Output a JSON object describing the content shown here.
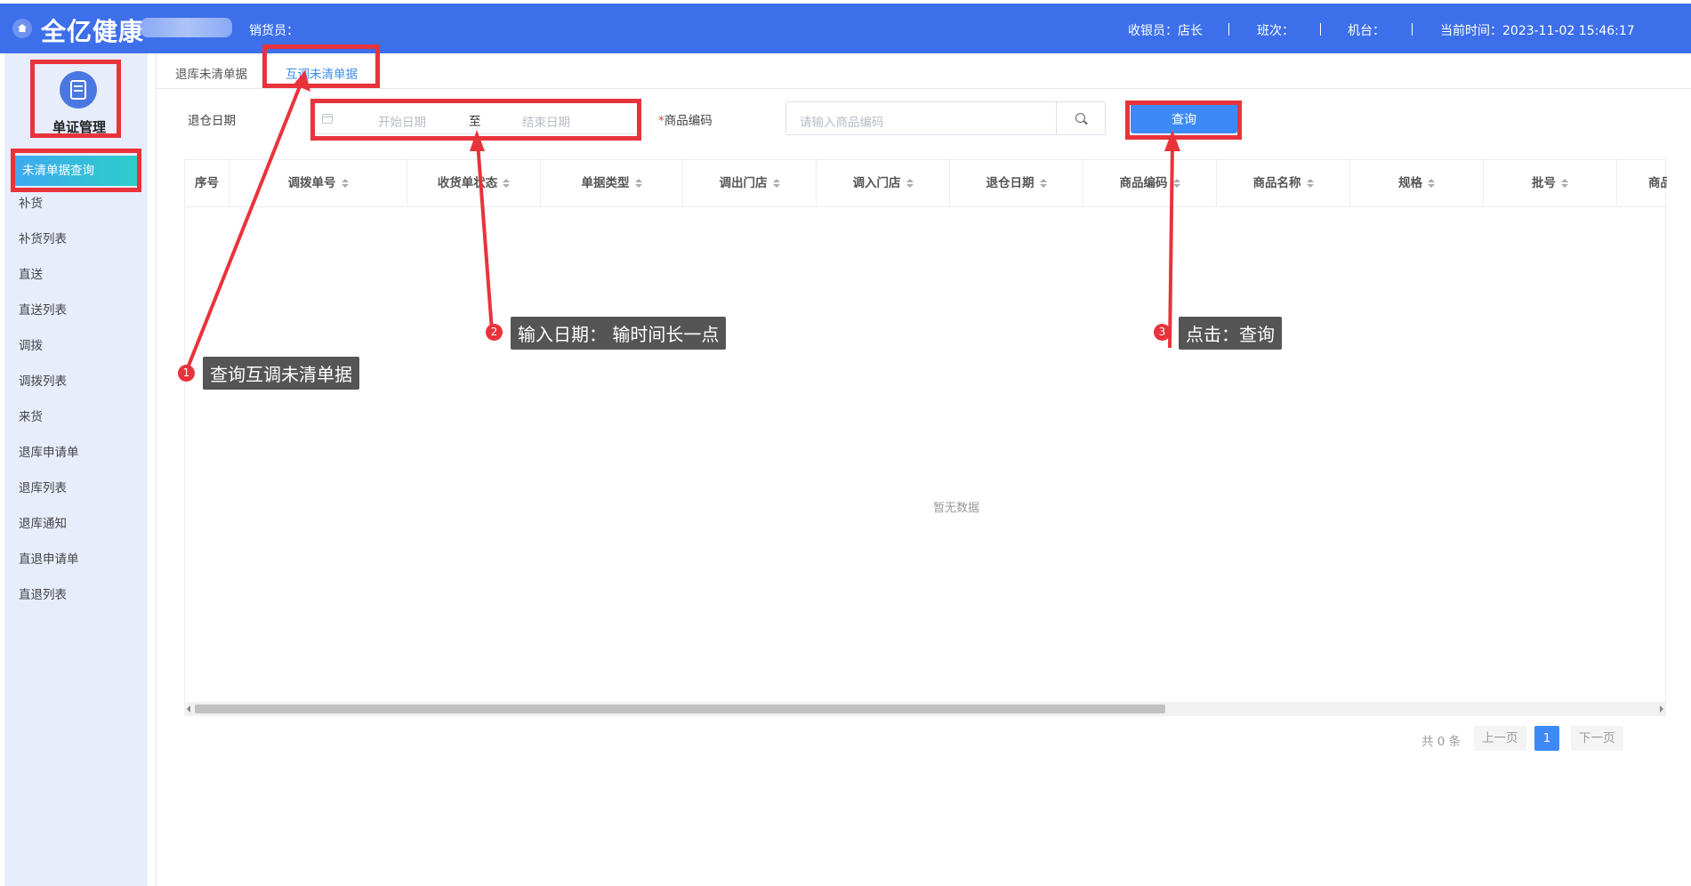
{
  "header": {
    "logo": "全亿健康",
    "salesperson_label": "销货员：",
    "cashier": "收银员：店长",
    "shift": "班次：",
    "terminal": "机台：",
    "current_time": "当前时间：2023-11-02 15:46:17"
  },
  "sidebar": {
    "title": "单证管理",
    "items": [
      {
        "label": "未清单据查询",
        "active": true
      },
      {
        "label": "补货"
      },
      {
        "label": "补货列表"
      },
      {
        "label": "直送"
      },
      {
        "label": "直送列表"
      },
      {
        "label": "调拨"
      },
      {
        "label": "调拨列表"
      },
      {
        "label": "来货"
      },
      {
        "label": "退库申请单"
      },
      {
        "label": "退库列表"
      },
      {
        "label": "退库通知"
      },
      {
        "label": "直退申请单"
      },
      {
        "label": "直退列表"
      }
    ]
  },
  "tabs": [
    {
      "label": "退库未清单据"
    },
    {
      "label": "互调未清单据",
      "active": true
    }
  ],
  "filters": {
    "date_label": "退仓日期",
    "start_placeholder": "开始日期",
    "range_sep": "至",
    "end_placeholder": "结束日期",
    "required_mark": "*",
    "code_label": "商品编码",
    "code_placeholder": "请输入商品编码",
    "query_button": "查询"
  },
  "table": {
    "columns": [
      "序号",
      "调拨单号",
      "收货单状态",
      "单据类型",
      "调出门店",
      "调入门店",
      "退仓日期",
      "商品编码",
      "商品名称",
      "规格",
      "批号",
      "商品"
    ],
    "empty_text": "暂无数据"
  },
  "pagination": {
    "total": "共 0 条",
    "prev": "上一页",
    "current": "1",
    "next": "下一页"
  },
  "annotations": [
    {
      "num": "1",
      "text": "查询互调未清单据"
    },
    {
      "num": "2",
      "text": "输入日期： 输时间长一点"
    },
    {
      "num": "3",
      "text": "点击：查询"
    }
  ],
  "colors": {
    "topbar": "#3d6fea",
    "accent": "#3d8af7",
    "annotation_red": "#e8333b"
  }
}
